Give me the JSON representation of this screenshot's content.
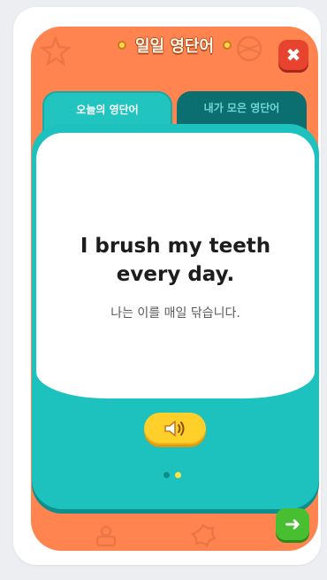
{
  "title": "일일 영단어",
  "tabs": [
    {
      "label": "오늘의 영단어",
      "active": true
    },
    {
      "label": "내가 모은 영단어",
      "active": false
    }
  ],
  "card": {
    "sentence": "I brush my teeth\nevery day.",
    "meaning": "나는 이를 매일 닦습니다."
  },
  "pager": {
    "total": 2,
    "current": 2
  },
  "colors": {
    "frame": "#ff8450",
    "panel": "#1dc1bd",
    "close": "#e8432f",
    "audio": "#ffd02a",
    "next": "#47bf31"
  },
  "icons": {
    "close": "close-icon",
    "audio": "speaker-icon",
    "next": "arrow-right-icon"
  }
}
